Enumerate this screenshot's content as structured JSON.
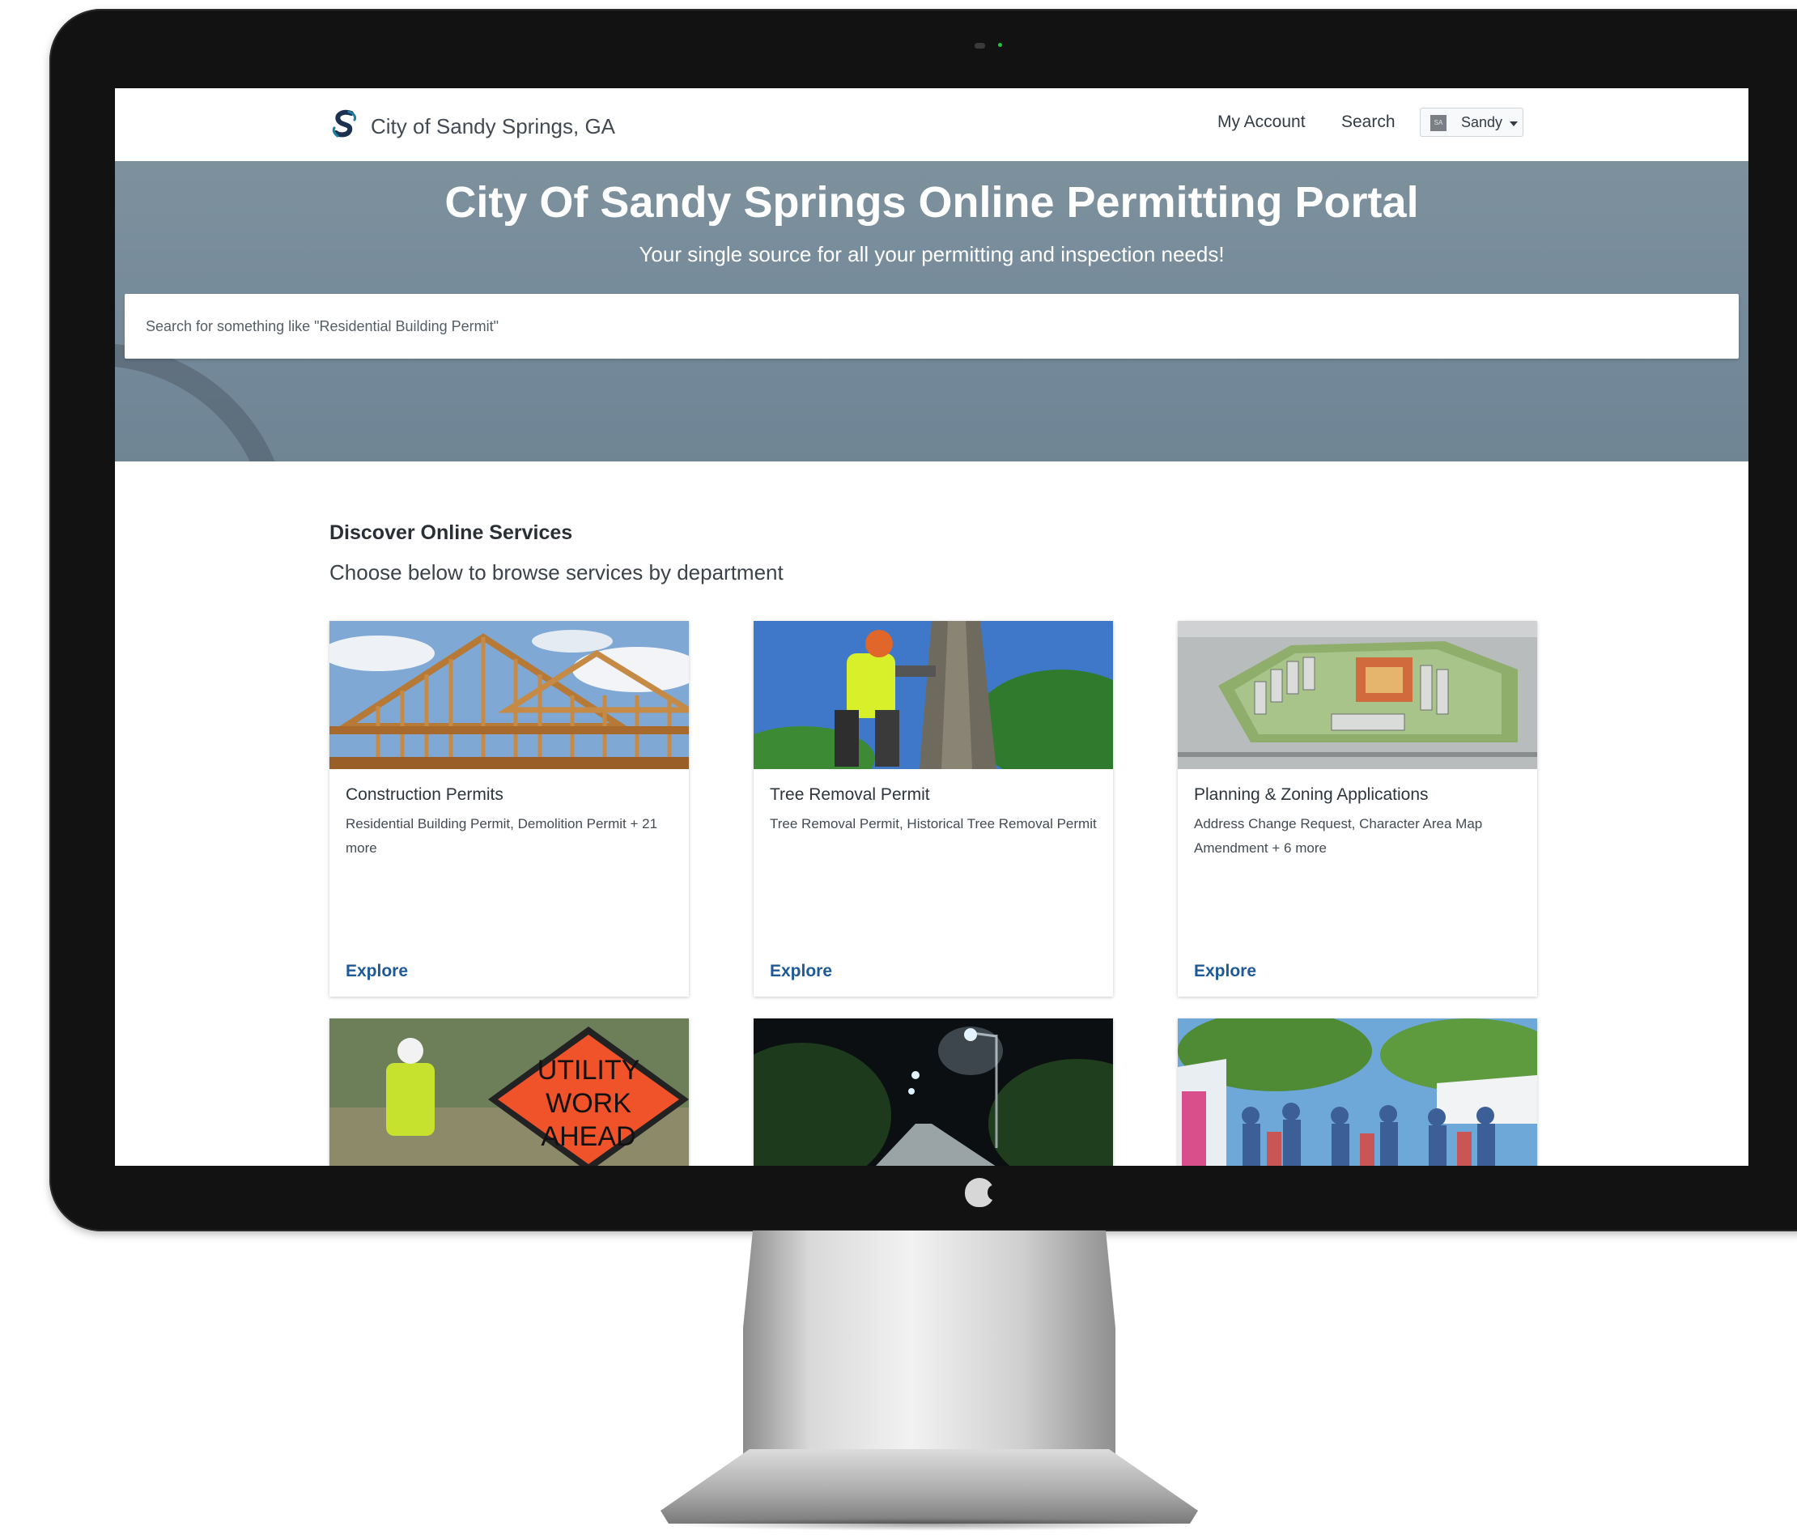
{
  "header": {
    "brand_name": "City of Sandy Springs, GA",
    "nav": {
      "my_account": "My Account",
      "search": "Search"
    },
    "user": {
      "avatar_initials": "SA",
      "name": "Sandy"
    }
  },
  "hero": {
    "title": "City Of Sandy Springs Online Permitting Portal",
    "subtitle": "Your single source for all your permitting and inspection needs!",
    "search_placeholder": "Search for something like \"Residential Building Permit\""
  },
  "services": {
    "heading": "Discover Online Services",
    "subheading": "Choose below to browse services by department",
    "cards": [
      {
        "title": "Construction Permits",
        "description": "Residential Building Permit, Demolition Permit + 21 more",
        "action": "Explore",
        "image_icon": "house-framing-photo"
      },
      {
        "title": "Tree Removal Permit",
        "description": "Tree Removal Permit, Historical Tree Removal Permit",
        "action": "Explore",
        "image_icon": "arborist-photo"
      },
      {
        "title": "Planning & Zoning Applications",
        "description": "Address Change Request, Character Area Map Amendment + 6 more",
        "action": "Explore",
        "image_icon": "site-plan-photo"
      }
    ],
    "lower_cards": [
      {
        "image_icon": "utility-work-photo",
        "sign_text": [
          "UTILITY",
          "WORK",
          "AHEAD"
        ]
      },
      {
        "image_icon": "street-light-photo"
      },
      {
        "image_icon": "festival-crowd-photo"
      }
    ]
  },
  "colors": {
    "hero_bg": "#74899a",
    "link_blue": "#1f5a98",
    "brand_teal": "#1d7ea0",
    "brand_navy": "#1c3050"
  }
}
